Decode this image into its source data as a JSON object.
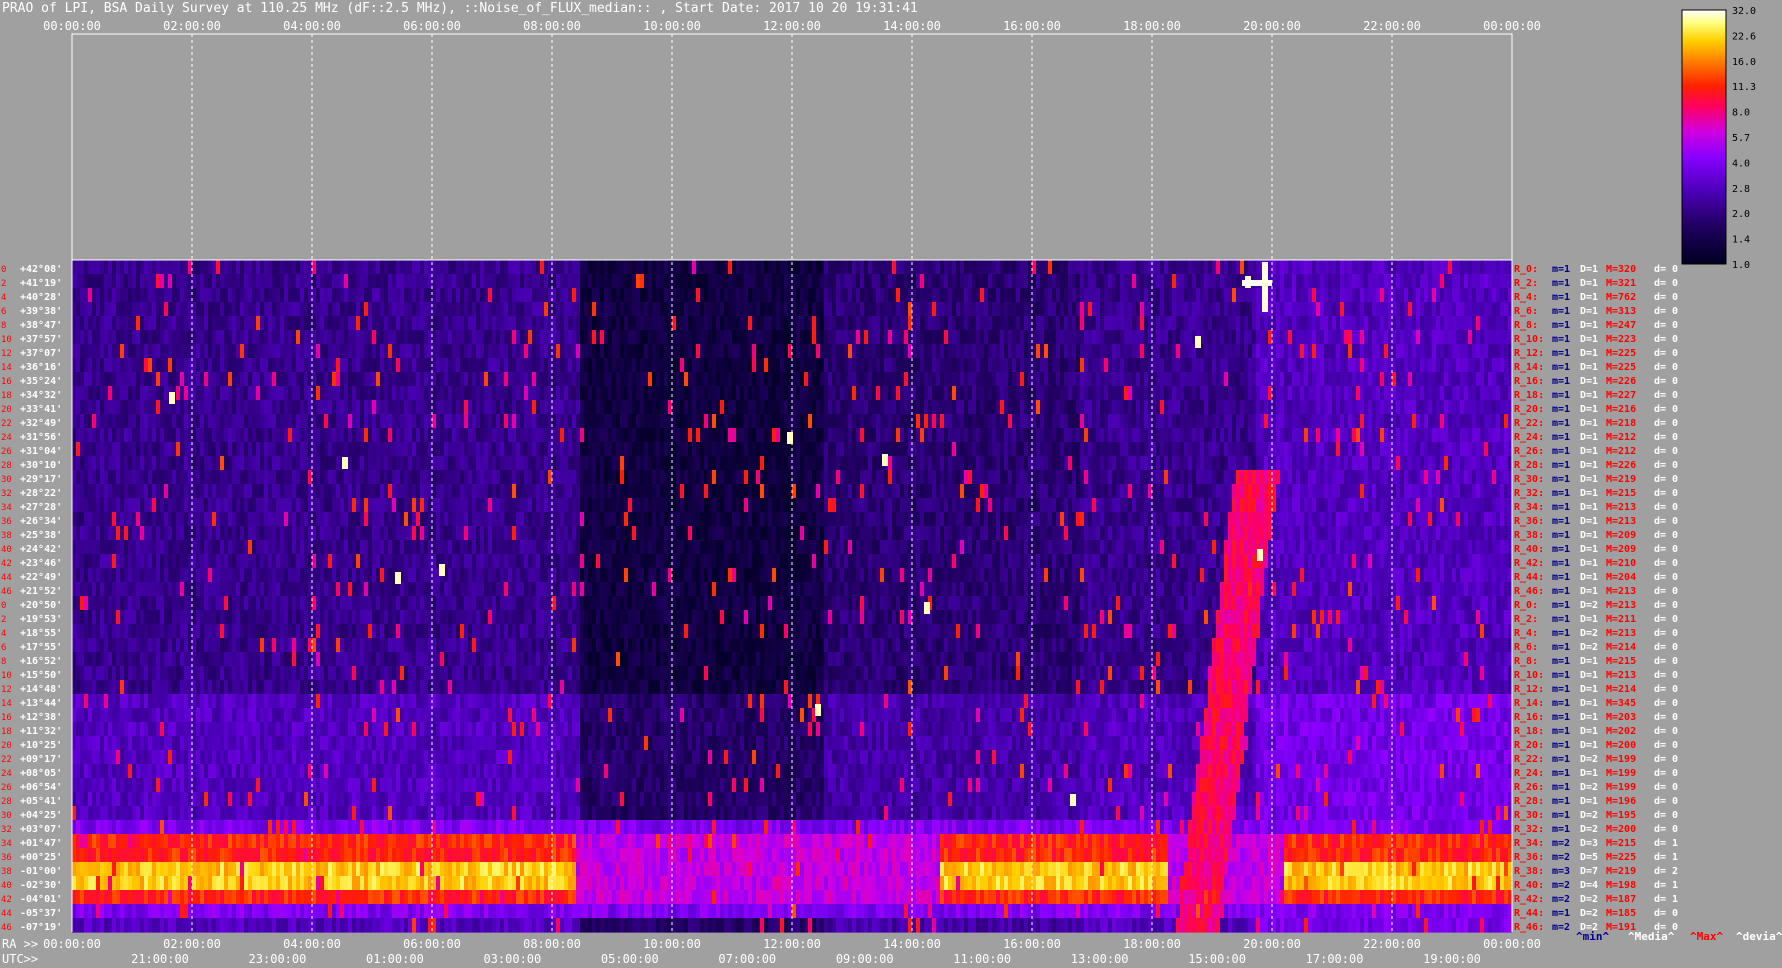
{
  "title": "PRAO of LPI, BSA Daily Survey at 110.25 MHz (dF::2.5 MHz), ::Noise_of_FLUX_median:: , Start Date: 2017 10 20 19:31:41",
  "chart_data": {
    "type": "heatmap",
    "title": "PRAO of LPI, BSA Daily Survey at 110.25 MHz (dF::2.5 MHz), ::Noise_of_FLUX_median:: , Start Date: 2017 10 20 19:31:41",
    "top_axis_ticks": [
      "00:00:00",
      "02:00:00",
      "04:00:00",
      "06:00:00",
      "08:00:00",
      "10:00:00",
      "12:00:00",
      "14:00:00",
      "16:00:00",
      "18:00:00",
      "20:00:00",
      "22:00:00",
      "00:00:00"
    ],
    "ra_axis_label": "RA >>",
    "ra_axis_ticks": [
      "00:00:00",
      "02:00:00",
      "04:00:00",
      "06:00:00",
      "08:00:00",
      "10:00:00",
      "12:00:00",
      "14:00:00",
      "16:00:00",
      "18:00:00",
      "20:00:00",
      "22:00:00",
      "00:00:00"
    ],
    "utc_axis_label": "UTC>>",
    "utc_axis_ticks": [
      "21:00:00",
      "23:00:00",
      "01:00:00",
      "03:00:00",
      "05:00:00",
      "07:00:00",
      "09:00:00",
      "11:00:00",
      "13:00:00",
      "15:00:00",
      "17:00:00",
      "19:00:00"
    ],
    "row_index_labels": [
      "0",
      "2",
      "4",
      "6",
      "8",
      "10",
      "12",
      "14",
      "16",
      "18",
      "20",
      "22",
      "24",
      "26",
      "28",
      "30",
      "32",
      "34",
      "36",
      "38",
      "40",
      "42",
      "44",
      "46",
      "0",
      "2",
      "4",
      "6",
      "8",
      "10",
      "12",
      "14",
      "16",
      "18",
      "20",
      "22",
      "24",
      "26",
      "28",
      "30",
      "32",
      "34",
      "36",
      "38",
      "40",
      "42",
      "44",
      "46"
    ],
    "declination_labels": [
      "+42°08'",
      "+41°19'",
      "+40°28'",
      "+39°38'",
      "+38°47'",
      "+37°57'",
      "+37°07'",
      "+36°16'",
      "+35°24'",
      "+34°32'",
      "+33°41'",
      "+32°49'",
      "+31°56'",
      "+31°04'",
      "+30°10'",
      "+29°17'",
      "+28°22'",
      "+27°28'",
      "+26°34'",
      "+25°38'",
      "+24°42'",
      "+23°46'",
      "+22°49'",
      "+21°52'",
      "+20°50'",
      "+19°53'",
      "+18°55'",
      "+17°55'",
      "+16°52'",
      "+15°50'",
      "+14°48'",
      "+13°44'",
      "+12°38'",
      "+11°32'",
      "+10°25'",
      "+09°17'",
      "+08°05'",
      "+06°54'",
      "+05°41'",
      "+04°25'",
      "+03°07'",
      "+01°47'",
      "+00°25'",
      "-01°00'",
      "-02°30'",
      "-04°01'",
      "-05°37'",
      "-07°19'"
    ],
    "row_stats": [
      {
        "r": "R_0:",
        "m": "m=1",
        "D": "D=1",
        "M": "M=320",
        "d": "d= 0"
      },
      {
        "r": "R_2:",
        "m": "m=1",
        "D": "D=1",
        "M": "M=321",
        "d": "d= 0"
      },
      {
        "r": "R_4:",
        "m": "m=1",
        "D": "D=1",
        "M": "M=762",
        "d": "d= 0"
      },
      {
        "r": "R_6:",
        "m": "m=1",
        "D": "D=1",
        "M": "M=313",
        "d": "d= 0"
      },
      {
        "r": "R_8:",
        "m": "m=1",
        "D": "D=1",
        "M": "M=247",
        "d": "d= 0"
      },
      {
        "r": "R_10:",
        "m": "m=1",
        "D": "D=1",
        "M": "M=223",
        "d": "d= 0"
      },
      {
        "r": "R_12:",
        "m": "m=1",
        "D": "D=1",
        "M": "M=225",
        "d": "d= 0"
      },
      {
        "r": "R_14:",
        "m": "m=1",
        "D": "D=1",
        "M": "M=225",
        "d": "d= 0"
      },
      {
        "r": "R_16:",
        "m": "m=1",
        "D": "D=1",
        "M": "M=226",
        "d": "d= 0"
      },
      {
        "r": "R_18:",
        "m": "m=1",
        "D": "D=1",
        "M": "M=227",
        "d": "d= 0"
      },
      {
        "r": "R_20:",
        "m": "m=1",
        "D": "D=1",
        "M": "M=216",
        "d": "d= 0"
      },
      {
        "r": "R_22:",
        "m": "m=1",
        "D": "D=1",
        "M": "M=218",
        "d": "d= 0"
      },
      {
        "r": "R_24:",
        "m": "m=1",
        "D": "D=1",
        "M": "M=212",
        "d": "d= 0"
      },
      {
        "r": "R_26:",
        "m": "m=1",
        "D": "D=1",
        "M": "M=212",
        "d": "d= 0"
      },
      {
        "r": "R_28:",
        "m": "m=1",
        "D": "D=1",
        "M": "M=226",
        "d": "d= 0"
      },
      {
        "r": "R_30:",
        "m": "m=1",
        "D": "D=1",
        "M": "M=219",
        "d": "d= 0"
      },
      {
        "r": "R_32:",
        "m": "m=1",
        "D": "D=1",
        "M": "M=215",
        "d": "d= 0"
      },
      {
        "r": "R_34:",
        "m": "m=1",
        "D": "D=1",
        "M": "M=213",
        "d": "d= 0"
      },
      {
        "r": "R_36:",
        "m": "m=1",
        "D": "D=1",
        "M": "M=213",
        "d": "d= 0"
      },
      {
        "r": "R_38:",
        "m": "m=1",
        "D": "D=1",
        "M": "M=209",
        "d": "d= 0"
      },
      {
        "r": "R_40:",
        "m": "m=1",
        "D": "D=1",
        "M": "M=209",
        "d": "d= 0"
      },
      {
        "r": "R_42:",
        "m": "m=1",
        "D": "D=1",
        "M": "M=210",
        "d": "d= 0"
      },
      {
        "r": "R_44:",
        "m": "m=1",
        "D": "D=1",
        "M": "M=204",
        "d": "d= 0"
      },
      {
        "r": "R_46:",
        "m": "m=1",
        "D": "D=1",
        "M": "M=213",
        "d": "d= 0"
      },
      {
        "r": "R_0:",
        "m": "m=1",
        "D": "D=2",
        "M": "M=213",
        "d": "d= 0"
      },
      {
        "r": "R_2:",
        "m": "m=1",
        "D": "D=1",
        "M": "M=211",
        "d": "d= 0"
      },
      {
        "r": "R_4:",
        "m": "m=1",
        "D": "D=2",
        "M": "M=213",
        "d": "d= 0"
      },
      {
        "r": "R_6:",
        "m": "m=1",
        "D": "D=2",
        "M": "M=214",
        "d": "d= 0"
      },
      {
        "r": "R_8:",
        "m": "m=1",
        "D": "D=1",
        "M": "M=215",
        "d": "d= 0"
      },
      {
        "r": "R_10:",
        "m": "m=1",
        "D": "D=1",
        "M": "M=213",
        "d": "d= 0"
      },
      {
        "r": "R_12:",
        "m": "m=1",
        "D": "D=1",
        "M": "M=214",
        "d": "d= 0"
      },
      {
        "r": "R_14:",
        "m": "m=1",
        "D": "D=1",
        "M": "M=345",
        "d": "d= 0"
      },
      {
        "r": "R_16:",
        "m": "m=1",
        "D": "D=1",
        "M": "M=203",
        "d": "d= 0"
      },
      {
        "r": "R_18:",
        "m": "m=1",
        "D": "D=1",
        "M": "M=202",
        "d": "d= 0"
      },
      {
        "r": "R_20:",
        "m": "m=1",
        "D": "D=1",
        "M": "M=200",
        "d": "d= 0"
      },
      {
        "r": "R_22:",
        "m": "m=1",
        "D": "D=2",
        "M": "M=199",
        "d": "d= 0"
      },
      {
        "r": "R_24:",
        "m": "m=1",
        "D": "D=1",
        "M": "M=199",
        "d": "d= 0"
      },
      {
        "r": "R_26:",
        "m": "m=1",
        "D": "D=2",
        "M": "M=199",
        "d": "d= 0"
      },
      {
        "r": "R_28:",
        "m": "m=1",
        "D": "D=1",
        "M": "M=196",
        "d": "d= 0"
      },
      {
        "r": "R_30:",
        "m": "m=1",
        "D": "D=2",
        "M": "M=195",
        "d": "d= 0"
      },
      {
        "r": "R_32:",
        "m": "m=1",
        "D": "D=2",
        "M": "M=200",
        "d": "d= 0"
      },
      {
        "r": "R_34:",
        "m": "m=2",
        "D": "D=3",
        "M": "M=215",
        "d": "d= 1"
      },
      {
        "r": "R_36:",
        "m": "m=2",
        "D": "D=5",
        "M": "M=225",
        "d": "d= 1"
      },
      {
        "r": "R_38:",
        "m": "m=3",
        "D": "D=7",
        "M": "M=219",
        "d": "d= 2"
      },
      {
        "r": "R_40:",
        "m": "m=2",
        "D": "D=4",
        "M": "M=198",
        "d": "d= 1"
      },
      {
        "r": "R_42:",
        "m": "m=2",
        "D": "D=2",
        "M": "M=187",
        "d": "d= 1"
      },
      {
        "r": "R_44:",
        "m": "m=1",
        "D": "D=2",
        "M": "M=185",
        "d": "d= 0"
      },
      {
        "r": "R_46:",
        "m": "m=2",
        "D": "D=2",
        "M": "M=191",
        "d": "d= 0"
      }
    ],
    "legend_labels": [
      "^min^",
      "^Media^",
      "^Max^",
      "^devia^"
    ],
    "colorbar_ticks": [
      "32.0",
      "22.6",
      "16.0",
      "11.3",
      "8.0",
      "5.7",
      "4.0",
      "2.8",
      "2.0",
      "1.4",
      "1.0"
    ],
    "colorbar_scale": "log",
    "colorbar_range": [
      1.0,
      32.0
    ],
    "colors": {
      "background": "#a0a0a0",
      "row_label_red": "#ff0000",
      "min_blue": "#000080",
      "max_red": "#ff0000"
    }
  }
}
